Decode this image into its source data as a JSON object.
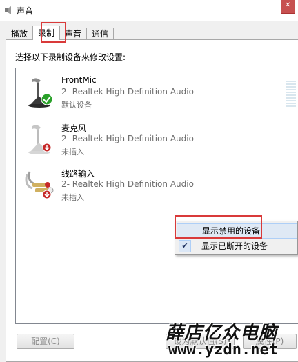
{
  "window": {
    "title": "声音",
    "close_icon": "close-icon"
  },
  "tabs": [
    {
      "label": "播放",
      "active": false
    },
    {
      "label": "录制",
      "active": true
    },
    {
      "label": "声音",
      "active": false
    },
    {
      "label": "通信",
      "active": false
    }
  ],
  "panel": {
    "instruction": "选择以下录制设备来修改设置:"
  },
  "devices": [
    {
      "name": "FrontMic",
      "description": "2- Realtek High Definition Audio",
      "status": "默认设备",
      "icon": "microphone-icon",
      "badge": "green-check-icon"
    },
    {
      "name": "麦克风",
      "description": "2- Realtek High Definition Audio",
      "status": "未插入",
      "icon": "microphone-icon",
      "badge": "red-unplugged-icon"
    },
    {
      "name": "线路输入",
      "description": "2- Realtek High Definition Audio",
      "status": "未插入",
      "icon": "line-in-cable-icon",
      "badge": "red-unplugged-icon"
    }
  ],
  "context_menu": {
    "items": [
      {
        "label": "显示禁用的设备",
        "checked": false
      },
      {
        "label": "显示已断开的设备",
        "checked": true
      }
    ]
  },
  "buttons": {
    "configure": "配置(C)",
    "set_default": "设为默认值(S)",
    "properties": "属性(P)"
  },
  "watermark": {
    "line1": "薛店亿众电脑",
    "line2": "www.yzdn.net"
  },
  "colors": {
    "highlight_border": "#d93a3a",
    "menu_hover": "#dfe9f5",
    "check_green": "#2aa12a",
    "unplugged_red": "#c62828"
  }
}
